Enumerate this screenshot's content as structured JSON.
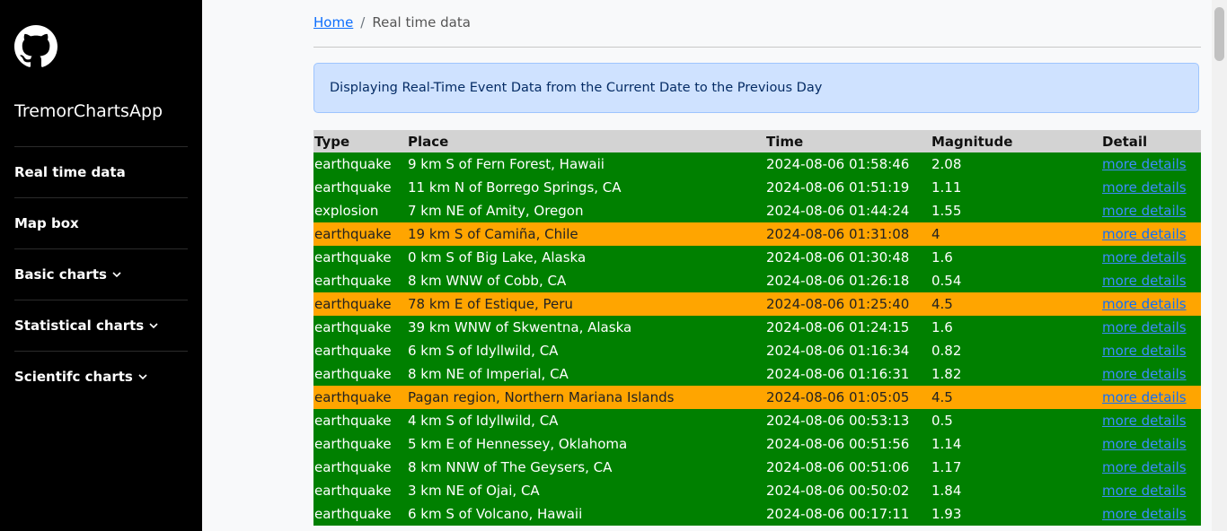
{
  "sidebar": {
    "app_name": "TremorChartsApp",
    "items": [
      {
        "label": "Real time data",
        "dropdown": false
      },
      {
        "label": "Map box",
        "dropdown": false
      },
      {
        "label": "Basic charts",
        "dropdown": true
      },
      {
        "label": "Statistical charts",
        "dropdown": true
      },
      {
        "label": "Scientifc charts",
        "dropdown": true
      }
    ]
  },
  "breadcrumb": {
    "home": "Home",
    "separator": "/",
    "current": "Real time data"
  },
  "alert": {
    "text": "Displaying Real-Time Event Data from the Current Date to the Previous Day"
  },
  "table": {
    "headers": [
      "Type",
      "Place",
      "Time",
      "Magnitude",
      "Detail"
    ],
    "rows": [
      {
        "type": "earthquake",
        "place": "9 km S of Fern Forest, Hawaii",
        "time": "2024-08-06 01:58:46",
        "magnitude": "2.08",
        "detail": "more details",
        "color": "green"
      },
      {
        "type": "earthquake",
        "place": "11 km N of Borrego Springs, CA",
        "time": "2024-08-06 01:51:19",
        "magnitude": "1.11",
        "detail": "more details",
        "color": "green"
      },
      {
        "type": "explosion",
        "place": "7 km NE of Amity, Oregon",
        "time": "2024-08-06 01:44:24",
        "magnitude": "1.55",
        "detail": "more details",
        "color": "green"
      },
      {
        "type": "earthquake",
        "place": "19 km S of Camiña, Chile",
        "time": "2024-08-06 01:31:08",
        "magnitude": "4",
        "detail": "more details",
        "color": "orange"
      },
      {
        "type": "earthquake",
        "place": "0 km S of Big Lake, Alaska",
        "time": "2024-08-06 01:30:48",
        "magnitude": "1.6",
        "detail": "more details",
        "color": "green"
      },
      {
        "type": "earthquake",
        "place": "8 km WNW of Cobb, CA",
        "time": "2024-08-06 01:26:18",
        "magnitude": "0.54",
        "detail": "more details",
        "color": "green"
      },
      {
        "type": "earthquake",
        "place": "78 km E of Estique, Peru",
        "time": "2024-08-06 01:25:40",
        "magnitude": "4.5",
        "detail": "more details",
        "color": "orange"
      },
      {
        "type": "earthquake",
        "place": "39 km WNW of Skwentna, Alaska",
        "time": "2024-08-06 01:24:15",
        "magnitude": "1.6",
        "detail": "more details",
        "color": "green"
      },
      {
        "type": "earthquake",
        "place": "6 km S of Idyllwild, CA",
        "time": "2024-08-06 01:16:34",
        "magnitude": "0.82",
        "detail": "more details",
        "color": "green"
      },
      {
        "type": "earthquake",
        "place": "8 km NE of Imperial, CA",
        "time": "2024-08-06 01:16:31",
        "magnitude": "1.82",
        "detail": "more details",
        "color": "green"
      },
      {
        "type": "earthquake",
        "place": "Pagan region, Northern Mariana Islands",
        "time": "2024-08-06 01:05:05",
        "magnitude": "4.5",
        "detail": "more details",
        "color": "orange"
      },
      {
        "type": "earthquake",
        "place": "4 km S of Idyllwild, CA",
        "time": "2024-08-06 00:53:13",
        "magnitude": "0.5",
        "detail": "more details",
        "color": "green"
      },
      {
        "type": "earthquake",
        "place": "5 km E of Hennessey, Oklahoma",
        "time": "2024-08-06 00:51:56",
        "magnitude": "1.14",
        "detail": "more details",
        "color": "green"
      },
      {
        "type": "earthquake",
        "place": "8 km NNW of The Geysers, CA",
        "time": "2024-08-06 00:51:06",
        "magnitude": "1.17",
        "detail": "more details",
        "color": "green"
      },
      {
        "type": "earthquake",
        "place": "3 km NE of Ojai, CA",
        "time": "2024-08-06 00:50:02",
        "magnitude": "1.84",
        "detail": "more details",
        "color": "green"
      },
      {
        "type": "earthquake",
        "place": "6 km S of Volcano, Hawaii",
        "time": "2024-08-06 00:17:11",
        "magnitude": "1.93",
        "detail": "more details",
        "color": "green"
      }
    ]
  },
  "colors": {
    "low_magnitude": "#008000",
    "high_magnitude": "#ffa500",
    "header": "#d3d3d3",
    "sidebar": "#000000",
    "alert_bg": "#cfe2ff"
  },
  "icons": {
    "logo": "github-icon",
    "dropdown": "chevron-down-icon"
  }
}
